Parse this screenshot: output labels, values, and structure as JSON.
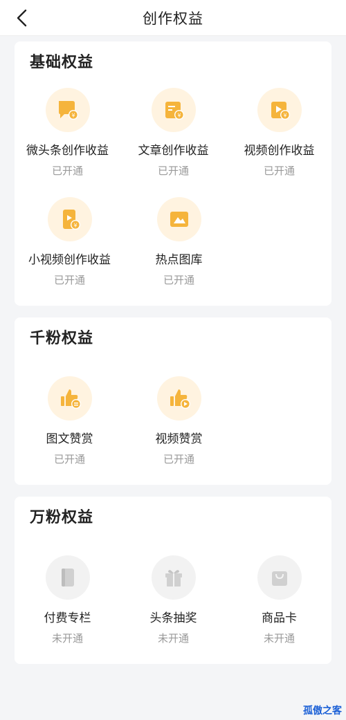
{
  "header": {
    "title": "创作权益"
  },
  "sections": [
    {
      "title": "基础权益",
      "items": [
        {
          "label": "微头条创作收益",
          "status": "已开通",
          "icon": "chat-bubble-yuan-icon"
        },
        {
          "label": "文章创作收益",
          "status": "已开通",
          "icon": "article-yuan-icon"
        },
        {
          "label": "视频创作收益",
          "status": "已开通",
          "icon": "video-yuan-icon"
        },
        {
          "label": "小视频创作收益",
          "status": "已开通",
          "icon": "short-video-yuan-icon"
        },
        {
          "label": "热点图库",
          "status": "已开通",
          "icon": "image-gallery-icon"
        }
      ]
    },
    {
      "title": "千粉权益",
      "items": [
        {
          "label": "图文赞赏",
          "status": "已开通",
          "icon": "thumbs-up-article-icon"
        },
        {
          "label": "视频赞赏",
          "status": "已开通",
          "icon": "thumbs-up-video-icon"
        }
      ]
    },
    {
      "title": "万粉权益",
      "items": [
        {
          "label": "付费专栏",
          "status": "未开通",
          "icon": "book-icon"
        },
        {
          "label": "头条抽奖",
          "status": "未开通",
          "icon": "gift-box-icon"
        },
        {
          "label": "商品卡",
          "status": "未开通",
          "icon": "shopping-bag-icon"
        }
      ]
    }
  ],
  "watermark": "孤傲之客",
  "colors": {
    "accent": "#f5b43c",
    "accent_bg": "#fff3e0",
    "inactive": "#d0d0d0",
    "inactive_bg": "#f2f2f2"
  }
}
